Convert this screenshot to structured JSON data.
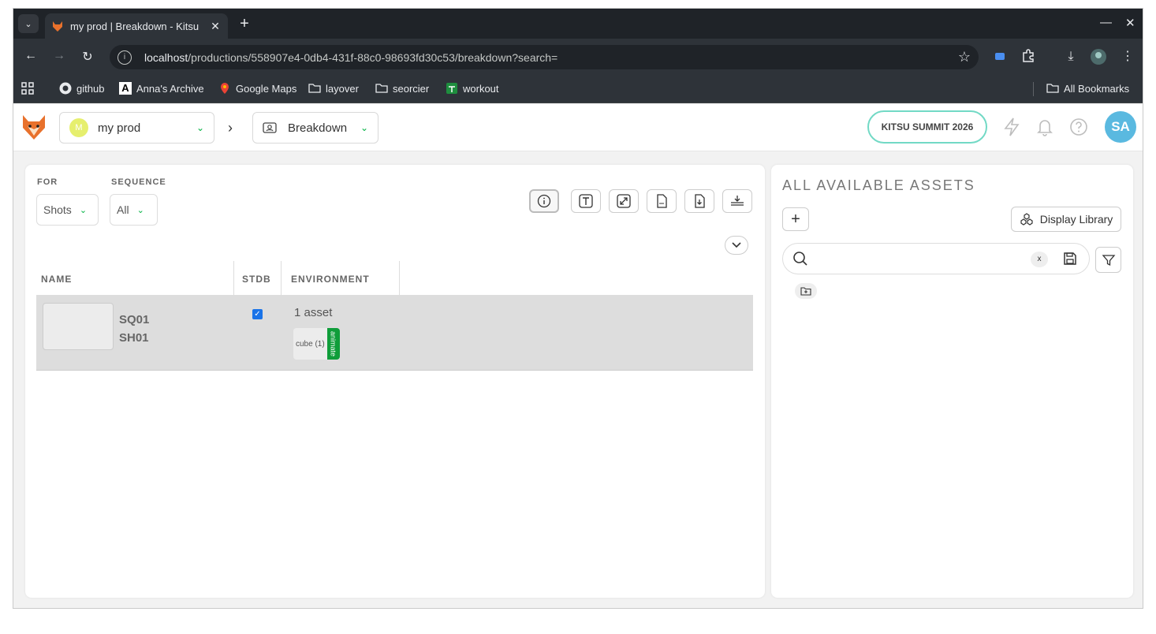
{
  "browser": {
    "tab_title": "my prod | Breakdown - Kitsu",
    "url_host": "localhost",
    "url_path": "/productions/558907e4-0db4-431f-88c0-98693fd30c53/breakdown?search=",
    "bookmarks": [
      "github",
      "Anna's Archive",
      "Google Maps",
      "layover",
      "seorcier",
      "workout"
    ],
    "all_bookmarks": "All Bookmarks"
  },
  "header": {
    "production_initial": "M",
    "production_name": "my prod",
    "section_name": "Breakdown",
    "summit_label": "KITSU SUMMIT 2026",
    "user_initials": "SA",
    "accent_color": "#00b242"
  },
  "filters": {
    "for_label": "FOR",
    "for_value": "Shots",
    "sequence_label": "SEQUENCE",
    "sequence_value": "All"
  },
  "table": {
    "columns": [
      "NAME",
      "STDB",
      "ENVIRONMENT"
    ],
    "rows": [
      {
        "sequence": "SQ01",
        "shot": "SH01",
        "stdb_checked": true,
        "asset_count": "1 asset",
        "asset_chip": "cube (1)",
        "asset_task": "animate"
      }
    ]
  },
  "right_panel": {
    "title": "ALL AVAILABLE ASSETS",
    "display_library": "Display Library",
    "search_clear": "x",
    "search_placeholder": ""
  }
}
